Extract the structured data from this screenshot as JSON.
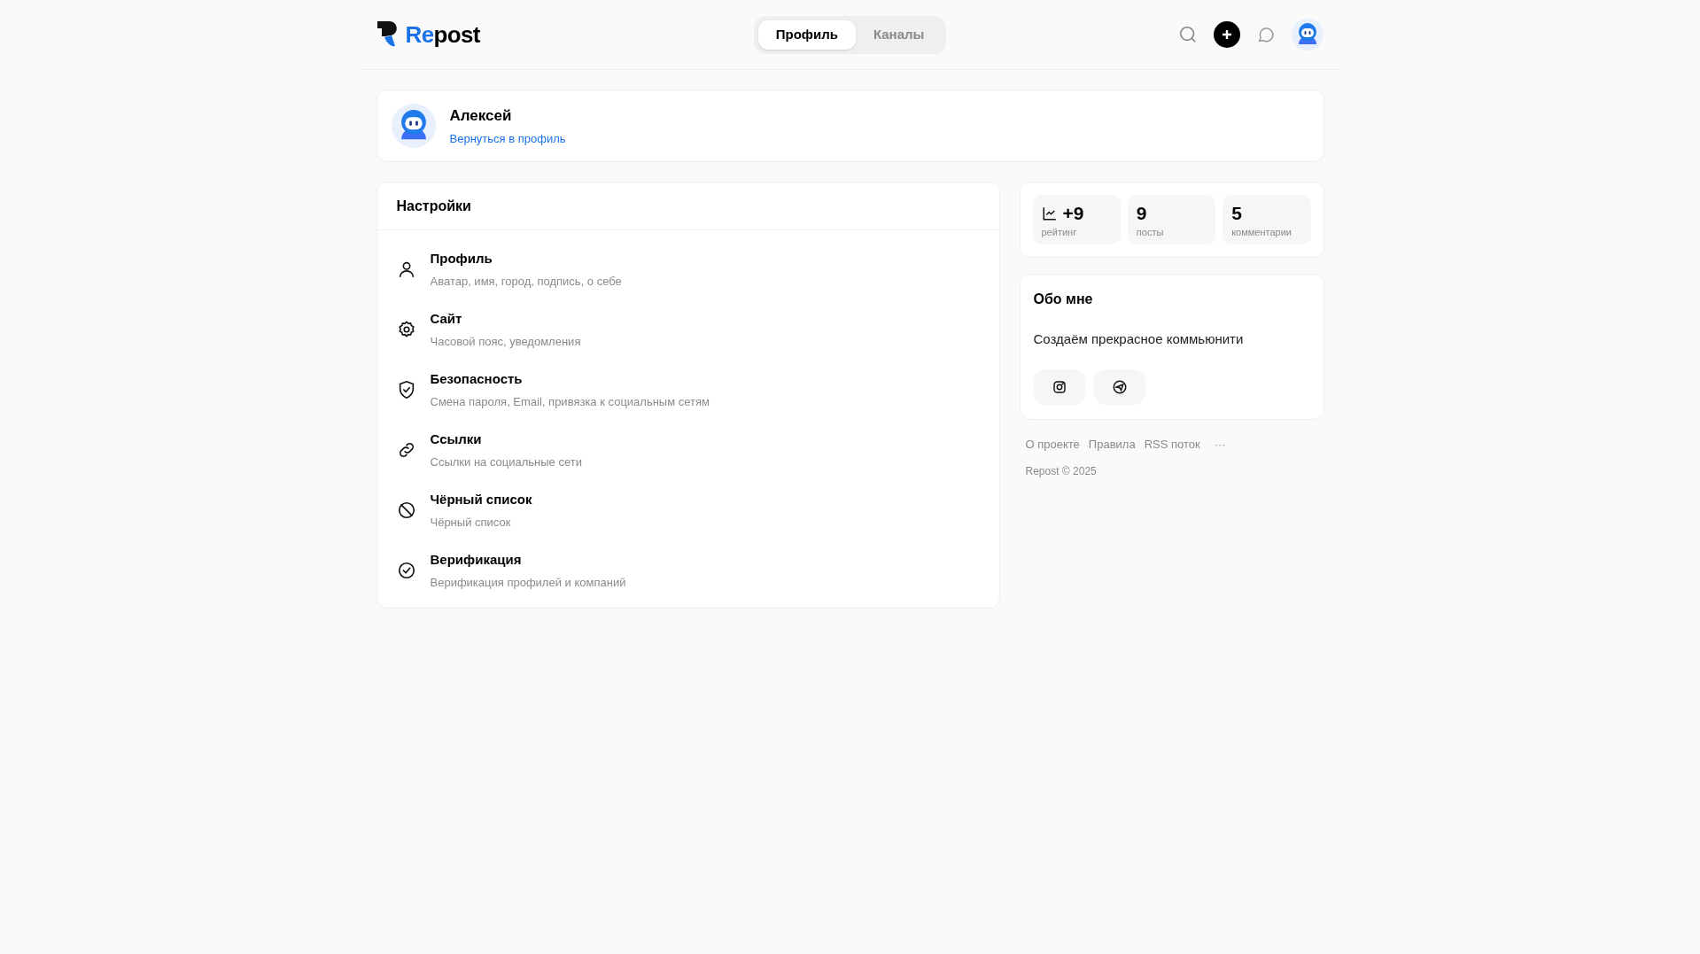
{
  "header": {
    "logo": {
      "accent": "Re",
      "rest": "post"
    },
    "tabs": [
      {
        "label": "Профиль",
        "selected": true
      },
      {
        "label": "Каналы",
        "selected": false
      }
    ]
  },
  "profile": {
    "name": "Алексей",
    "link": "Вернуться в профиль"
  },
  "settings": {
    "title": "Настройки",
    "items": [
      {
        "kind": "user",
        "title": "Профиль",
        "subtitle": "Аватар, имя, город, подпись, о себе"
      },
      {
        "kind": "gear",
        "title": "Сайт",
        "subtitle": "Часовой пояс, уведомления"
      },
      {
        "kind": "shield",
        "title": "Безопасность",
        "subtitle": "Смена пароля, Email, привязка к социальным сетям"
      },
      {
        "kind": "link",
        "title": "Ссылки",
        "subtitle": "Ссылки на социальные сети"
      },
      {
        "kind": "ban",
        "title": "Чёрный список",
        "subtitle": "Чёрный список"
      },
      {
        "kind": "check",
        "title": "Верификация",
        "subtitle": "Верификация профилей и компаний"
      }
    ]
  },
  "stats": [
    {
      "value": "+9",
      "label": "рейтинг",
      "trend_icon": true
    },
    {
      "value": "9",
      "label": "посты",
      "trend_icon": false
    },
    {
      "value": "5",
      "label": "комментарии",
      "trend_icon": false
    }
  ],
  "about": {
    "title": "Обо мне",
    "text": "Создаём прекрасное коммьюнити",
    "socials": [
      {
        "kind": "instagram"
      },
      {
        "kind": "telegram"
      }
    ]
  },
  "footer": {
    "links": [
      "О проекте",
      "Правила",
      "RSS поток"
    ],
    "more": "···",
    "copyright": "Repost © 2025"
  }
}
